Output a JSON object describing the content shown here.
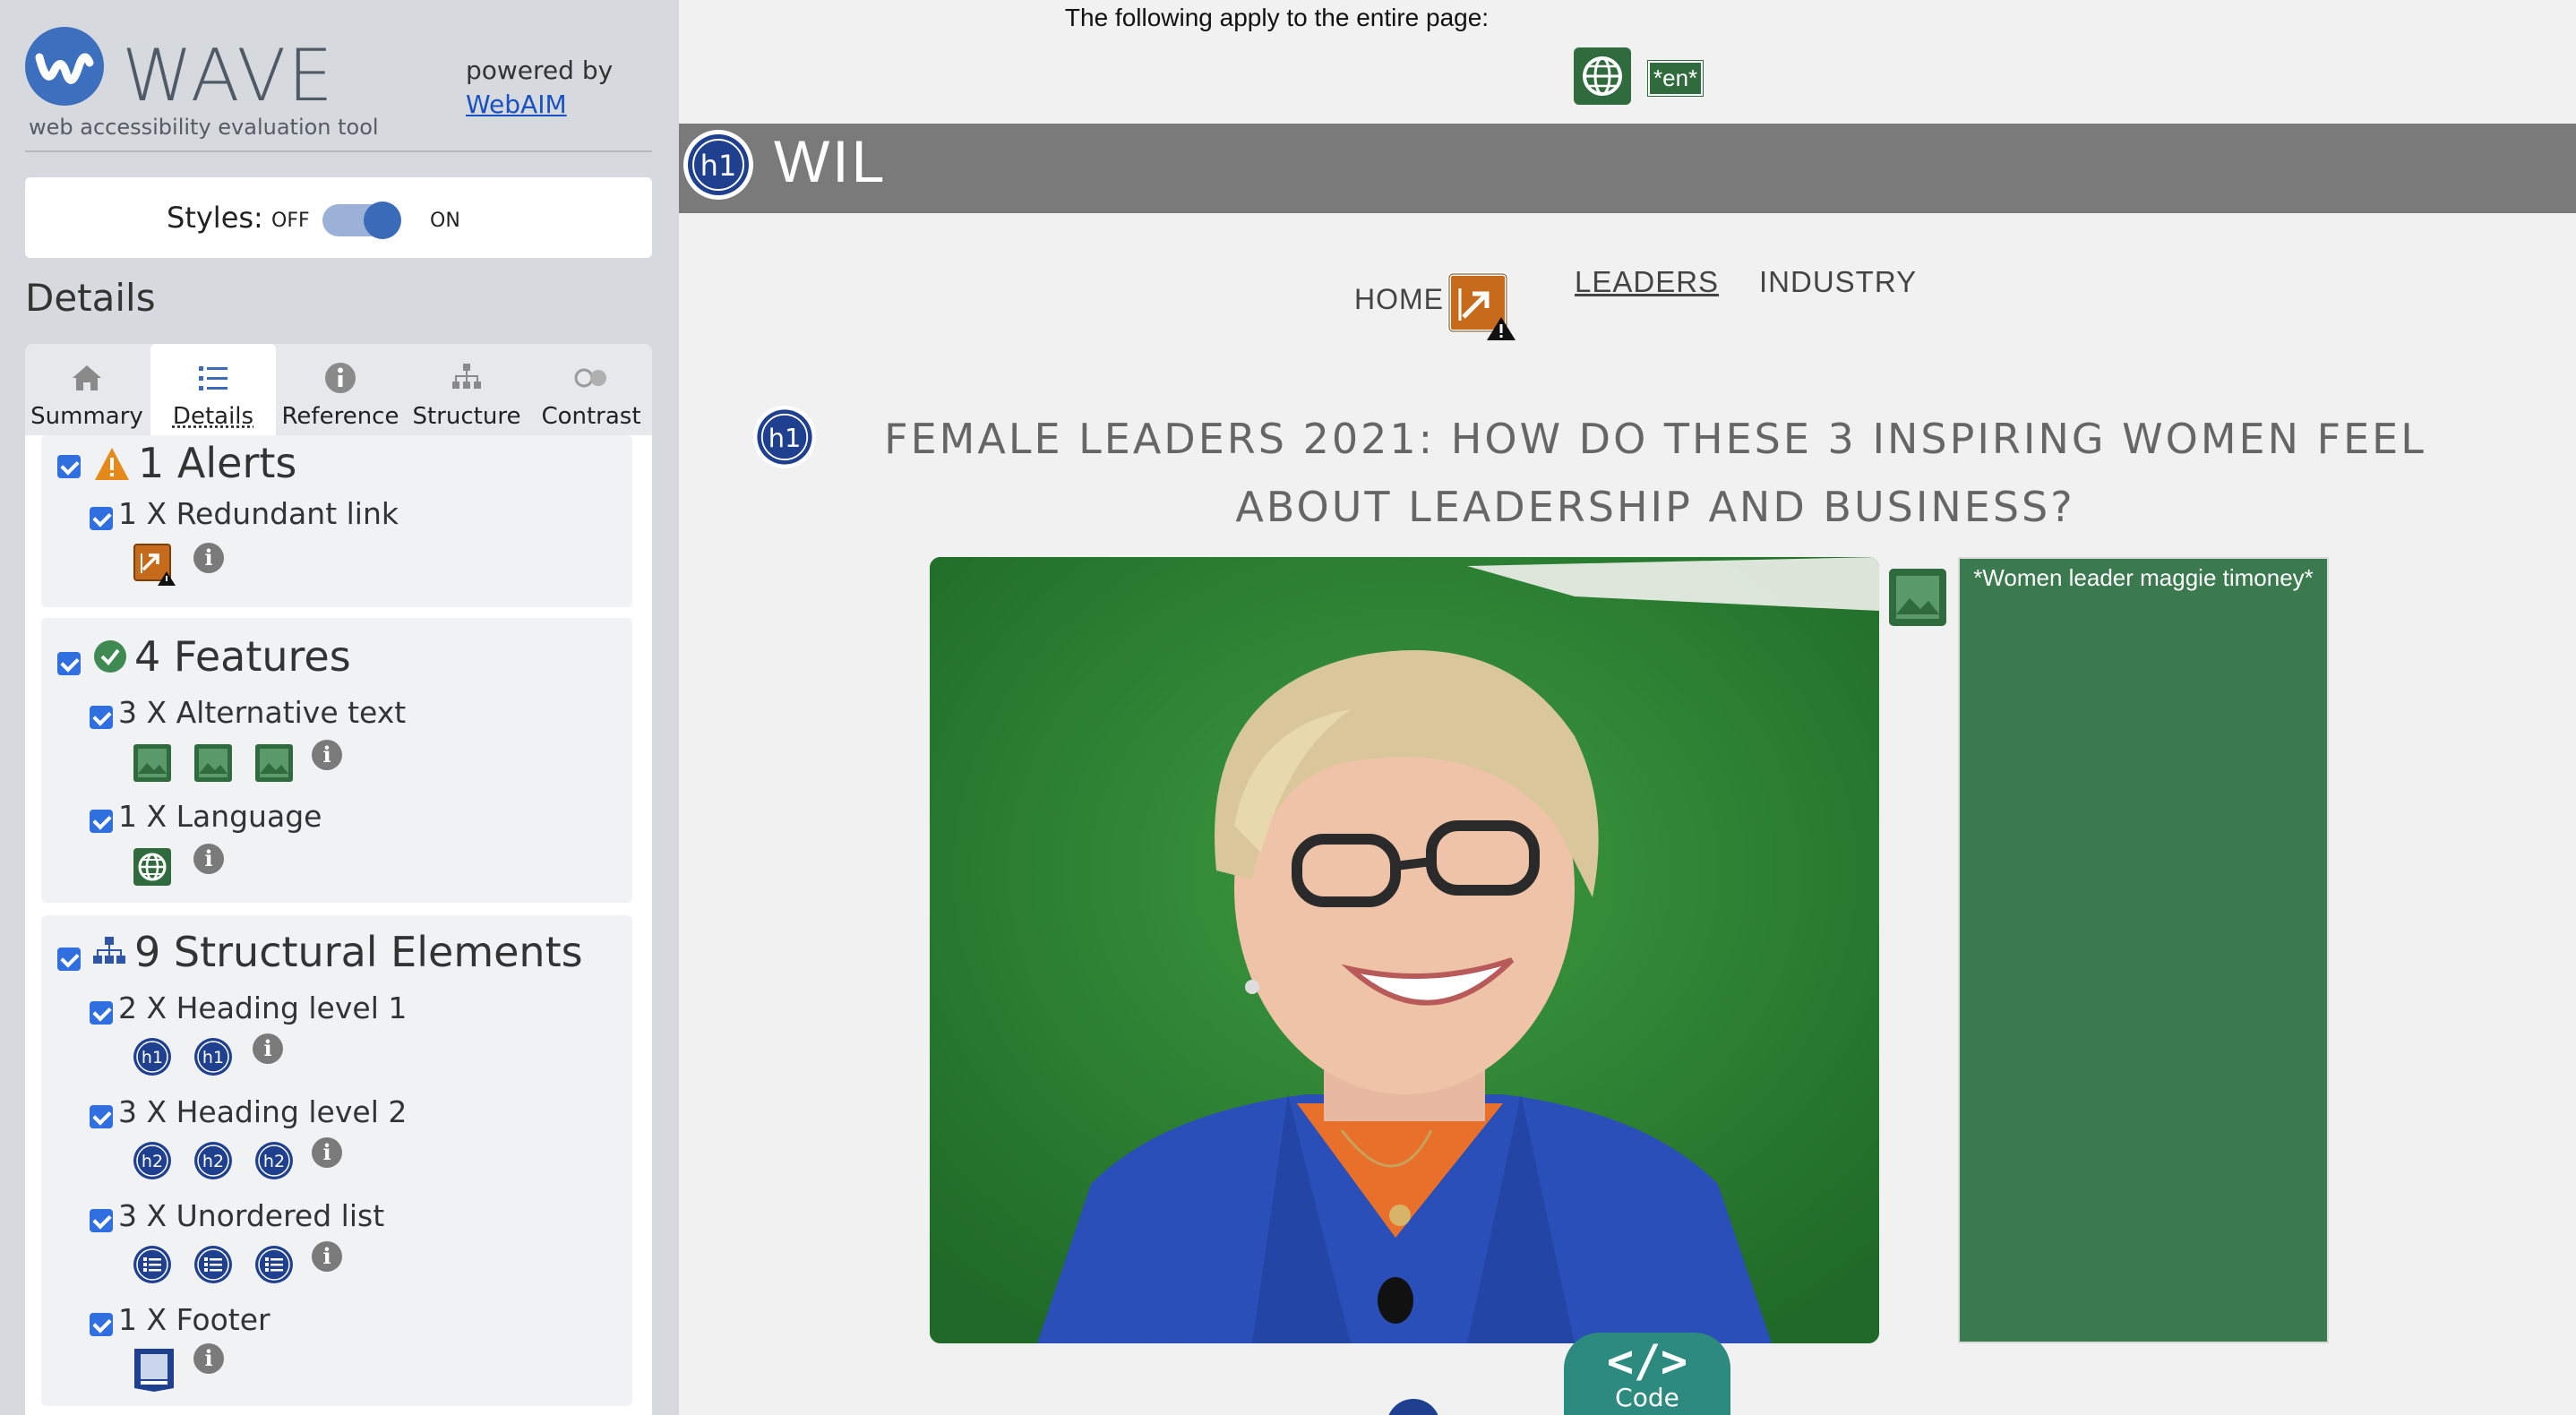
{
  "sidebar": {
    "title": "WAVE",
    "tagline": "web accessibility evaluation tool",
    "powered_by": "powered by",
    "webaim": "WebAIM",
    "styles_label": "Styles:",
    "styles_off": "OFF",
    "styles_on": "ON",
    "details_heading": "Details",
    "tabs": [
      {
        "label": "Summary",
        "icon": "home-icon"
      },
      {
        "label": "Details",
        "icon": "list-icon"
      },
      {
        "label": "Reference",
        "icon": "info-icon"
      },
      {
        "label": "Structure",
        "icon": "sitemap-icon"
      },
      {
        "label": "Contrast",
        "icon": "contrast-icon"
      }
    ],
    "alerts": {
      "title": "1 Alerts",
      "items": [
        {
          "label": "1 X Redundant link",
          "icon": "redundant-link-icon",
          "count": 1
        }
      ]
    },
    "features": {
      "title": "4 Features",
      "items": [
        {
          "label": "3 X Alternative text",
          "icon": "alt-text-icon",
          "count": 3
        },
        {
          "label": "1 X Language",
          "icon": "language-icon",
          "count": 1
        }
      ]
    },
    "structure": {
      "title": "9 Structural Elements",
      "items": [
        {
          "label": "2 X Heading level 1",
          "icon_text": "h1",
          "count": 2
        },
        {
          "label": "3 X Heading level 2",
          "icon_text": "h2",
          "count": 3
        },
        {
          "label": "3 X Unordered list",
          "icon": "unordered-list-icon",
          "count": 3
        },
        {
          "label": "1 X Footer",
          "icon": "footer-icon",
          "count": 1
        }
      ]
    }
  },
  "main": {
    "page_note": "The following apply to the entire page:",
    "lang_tag": "*en*",
    "site_title": "WIL",
    "h1_badge": "h1",
    "nav": {
      "home": "HOME",
      "leaders": "LEADERS",
      "industry": "INDUSTRY"
    },
    "article_title": "FEMALE LEADERS 2021: HOW DO THESE 3 INSPIRING WOMEN FEEL ABOUT LEADERSHIP AND BUSINESS?",
    "alt_text": "*Women leader maggie timoney*",
    "code_button": "Code",
    "colors": {
      "accent": "#2c8a7e",
      "feature_green": "#2f6b3c",
      "heading_blue": "#1f3f8f",
      "alert_orange": "#c66a1c"
    }
  }
}
